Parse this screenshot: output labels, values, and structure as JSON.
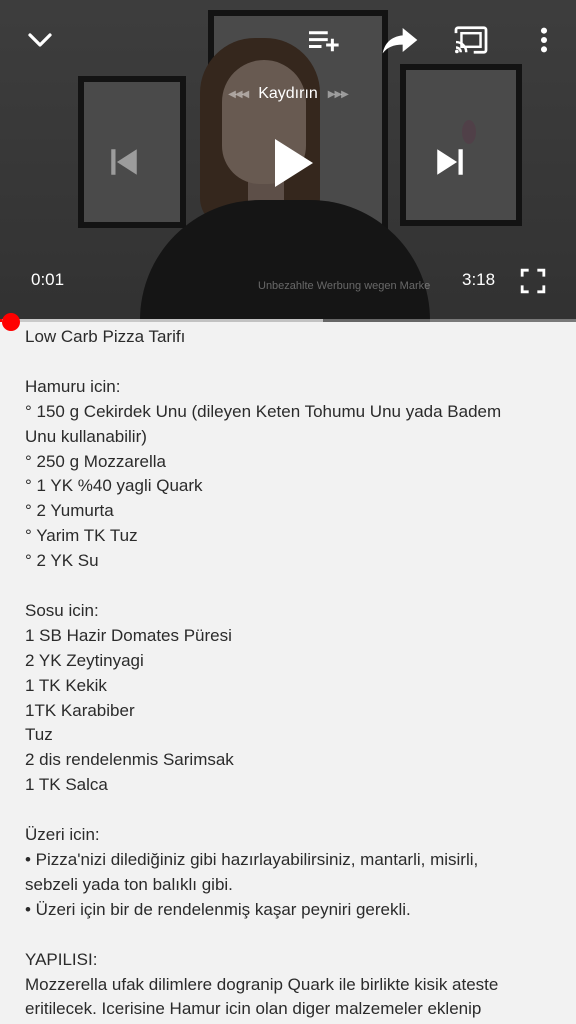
{
  "player": {
    "seek_label": "Kaydırın",
    "current_time": "0:01",
    "duration": "3:18",
    "watermark": "Unbezahlte Werbung wegen Marke",
    "progress_played_fraction": 0.003,
    "progress_buffered_fraction": 0.56,
    "accent_color": "#ff0000",
    "icons": {
      "minimize": "chevron-down-icon",
      "queue": "add-to-queue-icon",
      "share": "share-icon",
      "cast": "cast-icon",
      "more": "more-vert-icon",
      "previous": "skip-previous-icon",
      "play": "play-icon",
      "next": "skip-next-icon",
      "fullscreen": "fullscreen-icon"
    }
  },
  "description": {
    "lines": [
      "Low Carb Pizza Tarifı",
      "",
      "Hamuru icin:",
      "° 150 g Cekirdek Unu (dileyen Keten Tohumu Unu yada Badem",
      "Unu kullanabilir)",
      "° 250 g Mozzarella",
      "° 1 YK %40 yagli Quark",
      "° 2 Yumurta",
      "° Yarim TK Tuz",
      "° 2 YK Su",
      "",
      "Sosu icin:",
      "1 SB Hazir Domates Püresi",
      "2 YK Zeytinyagi",
      "1 TK Kekik",
      "1TK Karabiber",
      "Tuz",
      "2 dis rendelenmis Sarimsak",
      "1 TK Salca",
      "",
      "Üzeri icin:",
      "• Pizza'nizi dilediğiniz gibi hazırlayabilirsiniz,  mantarli, misirli,",
      "sebzeli yada ton balıklı gibi.",
      "• Üzeri için bir de rendelenmiş kaşar peyniri gerekli.",
      "",
      "YAPILISI:",
      "Mozzerella ufak dilimlere dogranip Quark ile birlikte kisik ateste",
      "eritilecek. Icerisine Hamur icin olan diger malzemeler eklenip"
    ]
  }
}
